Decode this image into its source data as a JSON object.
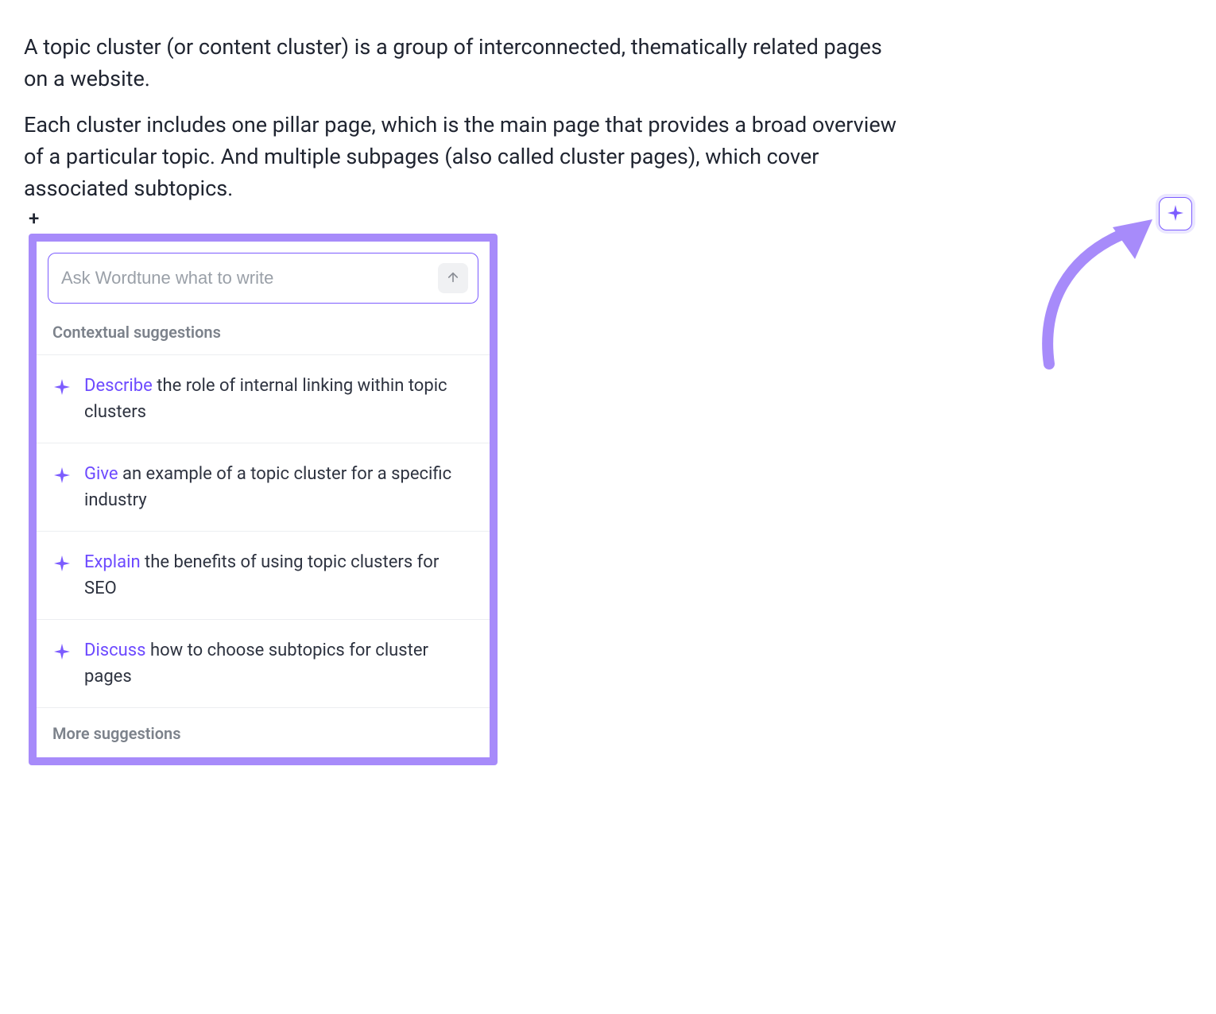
{
  "paragraphs": {
    "p1": "A topic cluster (or content cluster) is a group of interconnected, thematically related pages on a website.",
    "p2": "Each cluster includes one pillar page, which is the main page that provides a broad overview of a particular topic. And multiple subpages (also called cluster pages), which cover associated subtopics."
  },
  "plus": "+",
  "panel": {
    "input_placeholder": "Ask Wordtune what to write",
    "section_label": "Contextual suggestions",
    "suggestions": [
      {
        "verb": "Describe",
        "rest": " the role of internal linking within topic clusters"
      },
      {
        "verb": "Give",
        "rest": " an example of a topic cluster for a specific industry"
      },
      {
        "verb": "Explain",
        "rest": " the benefits of using topic clusters for SEO"
      },
      {
        "verb": "Discuss",
        "rest": " how to choose subtopics for cluster pages"
      }
    ],
    "more_label": "More suggestions"
  },
  "colors": {
    "accent": "#7c5cff",
    "panel_border": "#a78bfa"
  }
}
